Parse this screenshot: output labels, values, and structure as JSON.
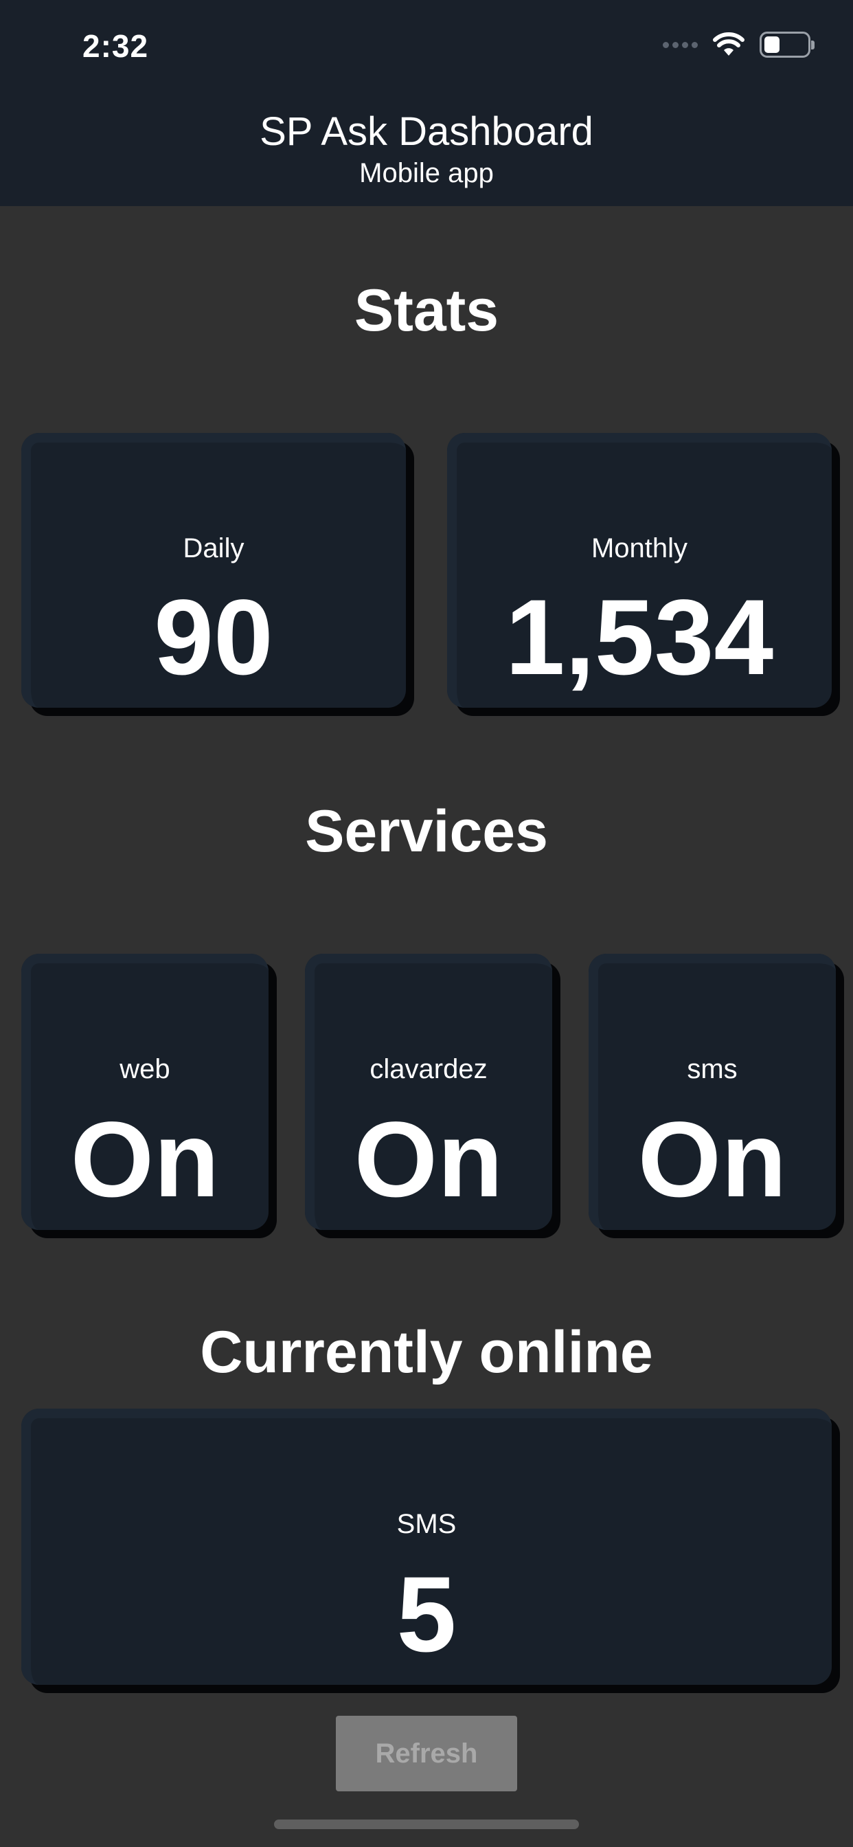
{
  "status_bar": {
    "time": "2:32",
    "icons": [
      "signal-dots-icon",
      "wifi-icon",
      "battery-icon"
    ],
    "battery_level_fraction": 0.35
  },
  "header": {
    "title": "SP Ask Dashboard",
    "subtitle": "Mobile app"
  },
  "stats": {
    "heading": "Stats",
    "cards": [
      {
        "label": "Daily",
        "value": "90"
      },
      {
        "label": "Monthly",
        "value": "1,534"
      }
    ]
  },
  "services": {
    "heading": "Services",
    "cards": [
      {
        "label": "web",
        "value": "On"
      },
      {
        "label": "clavardez",
        "value": "On"
      },
      {
        "label": "sms",
        "value": "On"
      }
    ]
  },
  "online": {
    "heading": "Currently online",
    "cards": [
      {
        "label": "SMS",
        "value": "5"
      }
    ]
  },
  "actions": {
    "refresh_label": "Refresh"
  },
  "colors": {
    "background": "#313131",
    "header": "#19202a",
    "card": "#18202a",
    "button": "#7b7b7b",
    "button_text": "#a9a9a9"
  }
}
